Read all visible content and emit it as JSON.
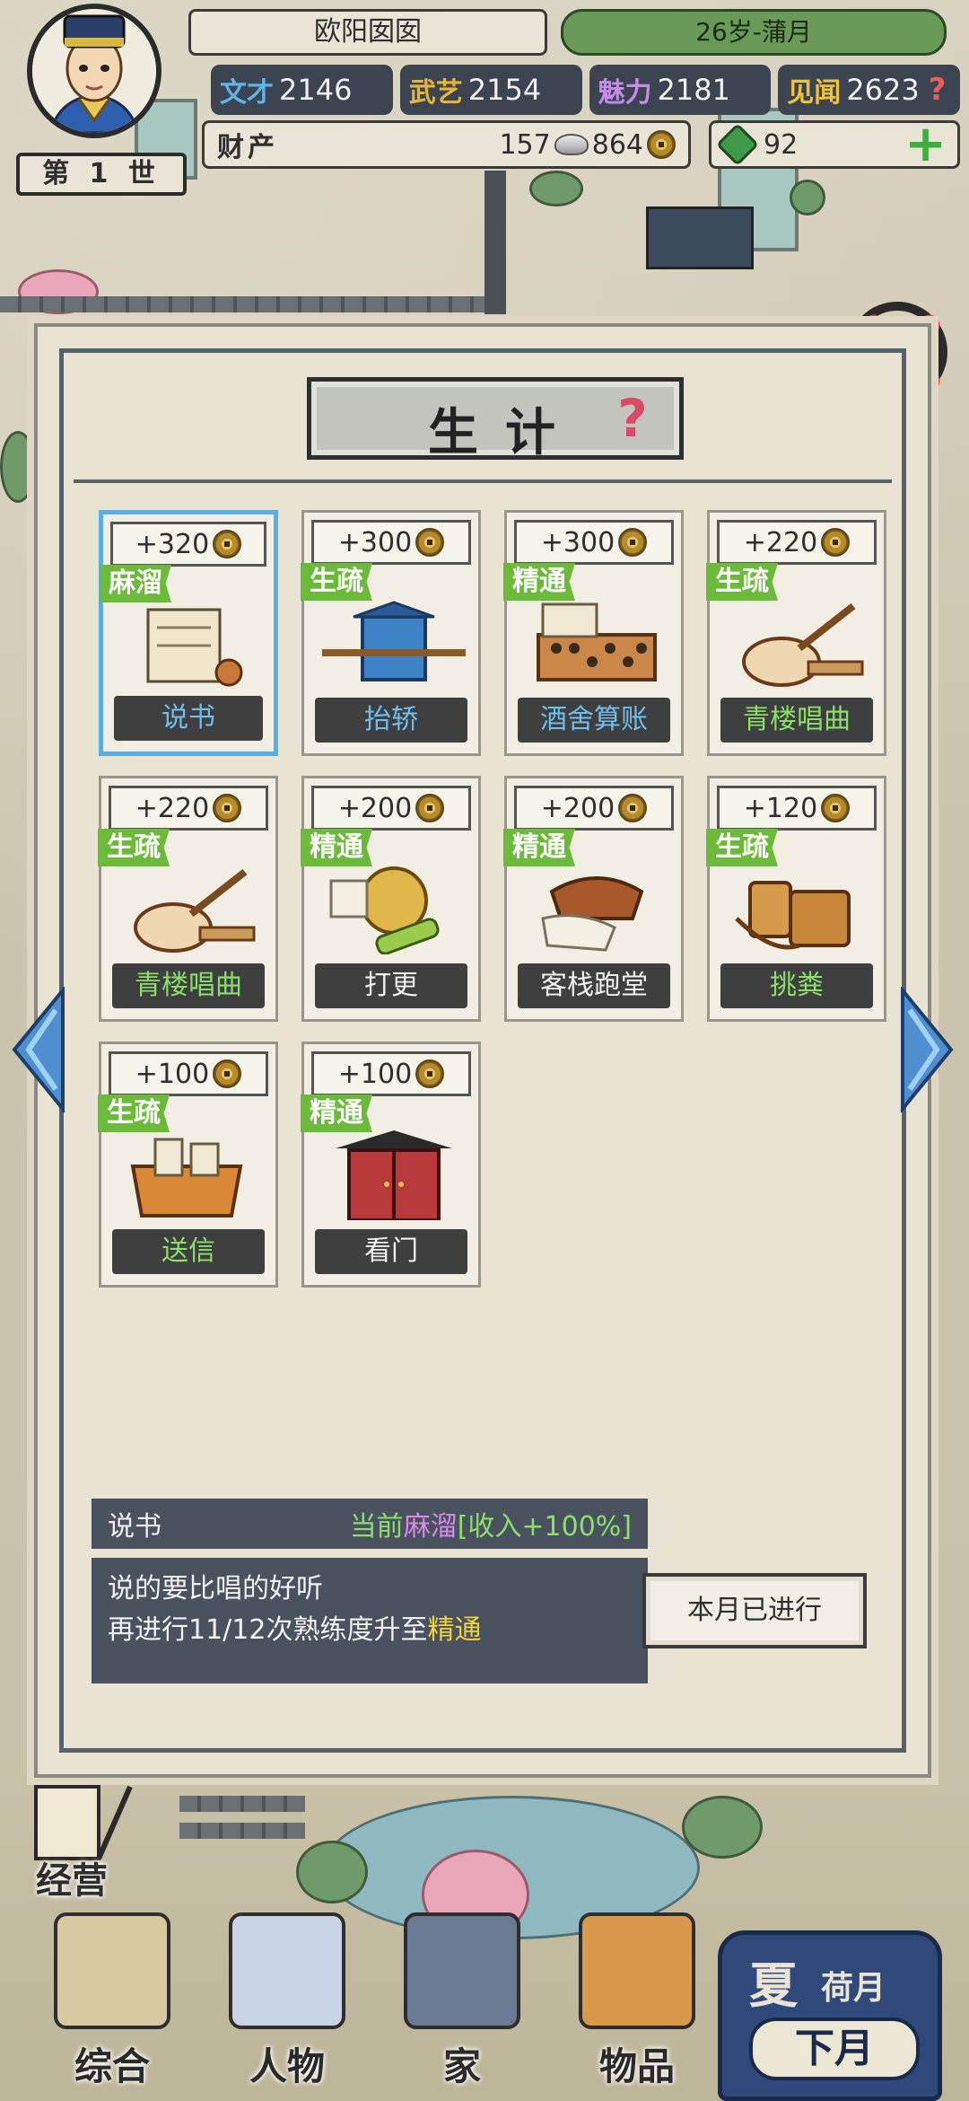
{
  "player": {
    "name": "欧阳囡囡",
    "age_month": "26岁-蒲月",
    "generation": "第 1 世"
  },
  "stats": [
    {
      "label": "文才",
      "value": "2146",
      "color": "#5fb4e8"
    },
    {
      "label": "武艺",
      "value": "2154",
      "color": "#e8b43a"
    },
    {
      "label": "魅力",
      "value": "2181",
      "color": "#c58ce8"
    },
    {
      "label": "见闻",
      "value": "2623",
      "color": "#f0c23a"
    }
  ],
  "stats_help": "?",
  "wealth": {
    "label": "财产",
    "silver": "157",
    "copper": "864"
  },
  "jade": {
    "value": "92",
    "plus": "+"
  },
  "panel": {
    "title": "生计",
    "help": "?"
  },
  "jobs": [
    {
      "reward": "+320",
      "level": "麻溜",
      "name": "说书",
      "art": "scroll-icon",
      "selected": true
    },
    {
      "reward": "+300",
      "level": "生疏",
      "name": "抬轿",
      "art": "sedan-chair-icon"
    },
    {
      "reward": "+300",
      "level": "精通",
      "name": "酒舍算账",
      "art": "abacus-icon"
    },
    {
      "reward": "+220",
      "level": "生疏",
      "name": "青楼唱曲",
      "art": "pipa-icon"
    },
    {
      "reward": "+220",
      "level": "生疏",
      "name": "青楼唱曲",
      "art": "pipa-icon"
    },
    {
      "reward": "+200",
      "level": "精通",
      "name": "打更",
      "art": "gong-icon"
    },
    {
      "reward": "+200",
      "level": "精通",
      "name": "客栈跑堂",
      "art": "towel-icon"
    },
    {
      "reward": "+120",
      "level": "生疏",
      "name": "挑粪",
      "art": "bucket-icon"
    },
    {
      "reward": "+100",
      "level": "生疏",
      "name": "送信",
      "art": "mailbag-icon"
    },
    {
      "reward": "+100",
      "level": "精通",
      "name": "看门",
      "art": "gate-icon"
    }
  ],
  "info": {
    "job": "说书",
    "current_prefix": "当前",
    "current_level": "麻溜",
    "current_bonus": "[收入+100%]",
    "desc_line1": "说的要比唱的好听",
    "desc_line2_prefix": "再进行11/12次熟练度升至",
    "desc_line2_level": "精通"
  },
  "done_button": "本月已进行",
  "bottom_nav": {
    "jingying": "经营",
    "items": [
      "综合",
      "人物",
      "家",
      "物品"
    ]
  },
  "season": {
    "season": "夏",
    "month": "荷月",
    "next": "下月"
  }
}
